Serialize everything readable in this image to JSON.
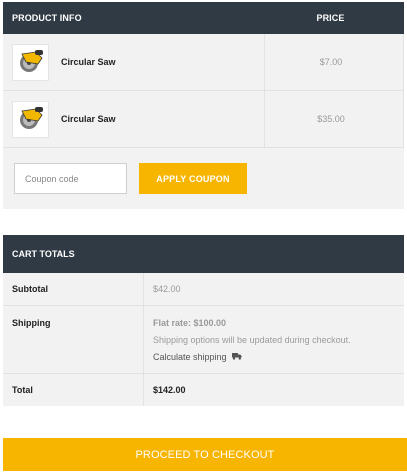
{
  "cart": {
    "headers": {
      "product": "PRODUCT INFO",
      "price": "PRICE"
    },
    "items": [
      {
        "name": "Circular Saw",
        "price": "$7.00",
        "icon": "circular-saw-icon"
      },
      {
        "name": "Circular Saw",
        "price": "$35.00",
        "icon": "circular-saw-icon"
      }
    ],
    "coupon": {
      "placeholder": "Coupon code",
      "button_label": "APPLY COUPON"
    }
  },
  "totals": {
    "title": "CART TOTALS",
    "subtotal": {
      "label": "Subtotal",
      "value": "$42.00"
    },
    "shipping": {
      "label": "Shipping",
      "flat_rate": "Flat rate: $100.00",
      "note": "Shipping options will be updated during checkout.",
      "calculate": "Calculate shipping",
      "icon": "truck-icon"
    },
    "total": {
      "label": "Total",
      "value": "$142.00"
    }
  },
  "checkout": {
    "label": "PROCEED TO CHECKOUT"
  },
  "colors": {
    "header_bg": "#2f3a45",
    "accent": "#f7b500",
    "panel_bg": "#f2f2f2"
  }
}
